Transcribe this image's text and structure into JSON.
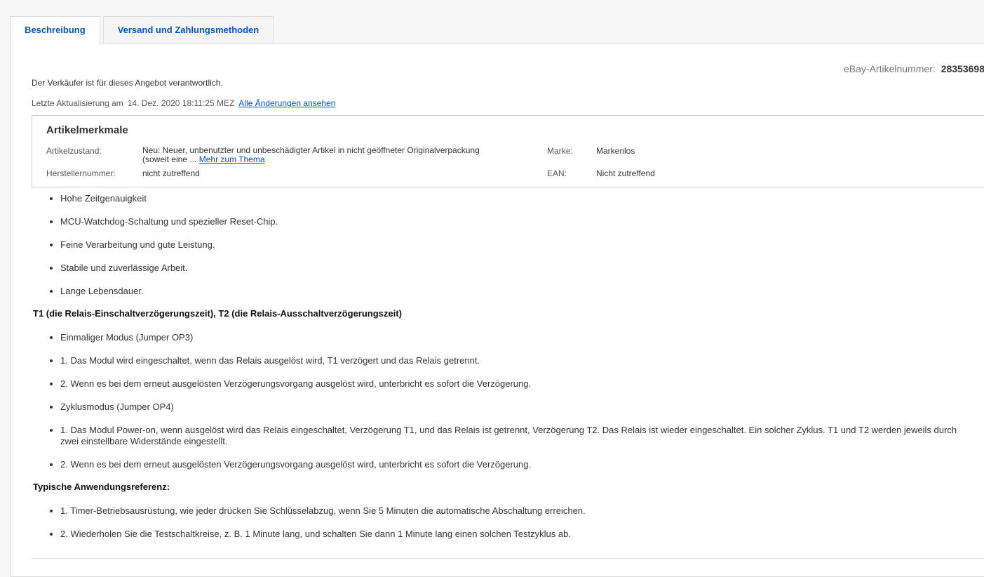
{
  "tabs": [
    {
      "label": "Beschreibung",
      "active": true
    },
    {
      "label": "Versand und Zahlungsmethoden",
      "active": false
    }
  ],
  "item_number": {
    "label": "eBay-Artikelnummer:",
    "value": "28353698"
  },
  "responsible_text": "Der Verkäufer ist für dieses Angebot verantwortlich.",
  "last_update": {
    "label": "Letzte Aktualisierung am",
    "date": "14. Dez. 2020 18:11:25 MEZ",
    "link": "Alle Änderungen ansehen"
  },
  "specifics": {
    "title": "Artikelmerkmale",
    "condition_label": "Artikelzustand:",
    "condition_value_line1": "Neu: Neuer, unbenutzter und unbeschädigter Artikel in nicht geöffneter Originalverpackung",
    "condition_value_line2": "(soweit eine ...",
    "condition_more_link": "Mehr zum Thema",
    "brand_label": "Marke:",
    "brand_value": "Markenlos",
    "mpn_label": "Herstellernummer:",
    "mpn_value": "nicht zutreffend",
    "ean_label": "EAN:",
    "ean_value": "Nicht zutreffend"
  },
  "description": {
    "features": [
      "Hohe Zeitgenauigkeit",
      "MCU-Watchdog-Schaltung und spezieller Reset-Chip.",
      "Feine Verarbeitung und gute Leistung.",
      "Stabile und zuverlässige Arbeit.",
      "Lange Lebensdauer."
    ],
    "heading1": "T1 (die Relais-Einschaltverzögerungszeit), T2 (die Relais-Ausschaltverzögerungszeit)",
    "modes": [
      "Einmaliger Modus (Jumper OP3)",
      "1. Das Modul wird eingeschaltet, wenn das Relais ausgelöst wird, T1 verzögert und das Relais getrennt.",
      "2. Wenn es bei dem erneut ausgelösten Verzögerungsvorgang ausgelöst wird, unterbricht es sofort die Verzögerung.",
      "Zyklusmodus (Jumper OP4)",
      "1. Das Modul Power-on, wenn ausgelöst wird das Relais eingeschaltet, Verzögerung T1, und das Relais ist getrennt, Verzögerung T2. Das Relais ist wieder eingeschaltet. Ein solcher Zyklus. T1 und T2 werden jeweils durch zwei einstellbare Widerstände eingestellt.",
      "2. Wenn es bei dem erneut ausgelösten Verzögerungsvorgang ausgelöst wird, unterbricht es sofort die Verzögerung."
    ],
    "heading2": "Typische Anwendungsreferenz:",
    "applications": [
      "1. Timer-Betriebsausrüstung, wie jeder drücken Sie Schlüsselabzug, wenn Sie 5 Minuten die automatische Abschaltung erreichen.",
      "2. Wiederholen Sie die Testschaltkreise, z. B. 1 Minute lang, und schalten Sie dann 1 Minute lang einen solchen Testzyklus ab."
    ]
  }
}
